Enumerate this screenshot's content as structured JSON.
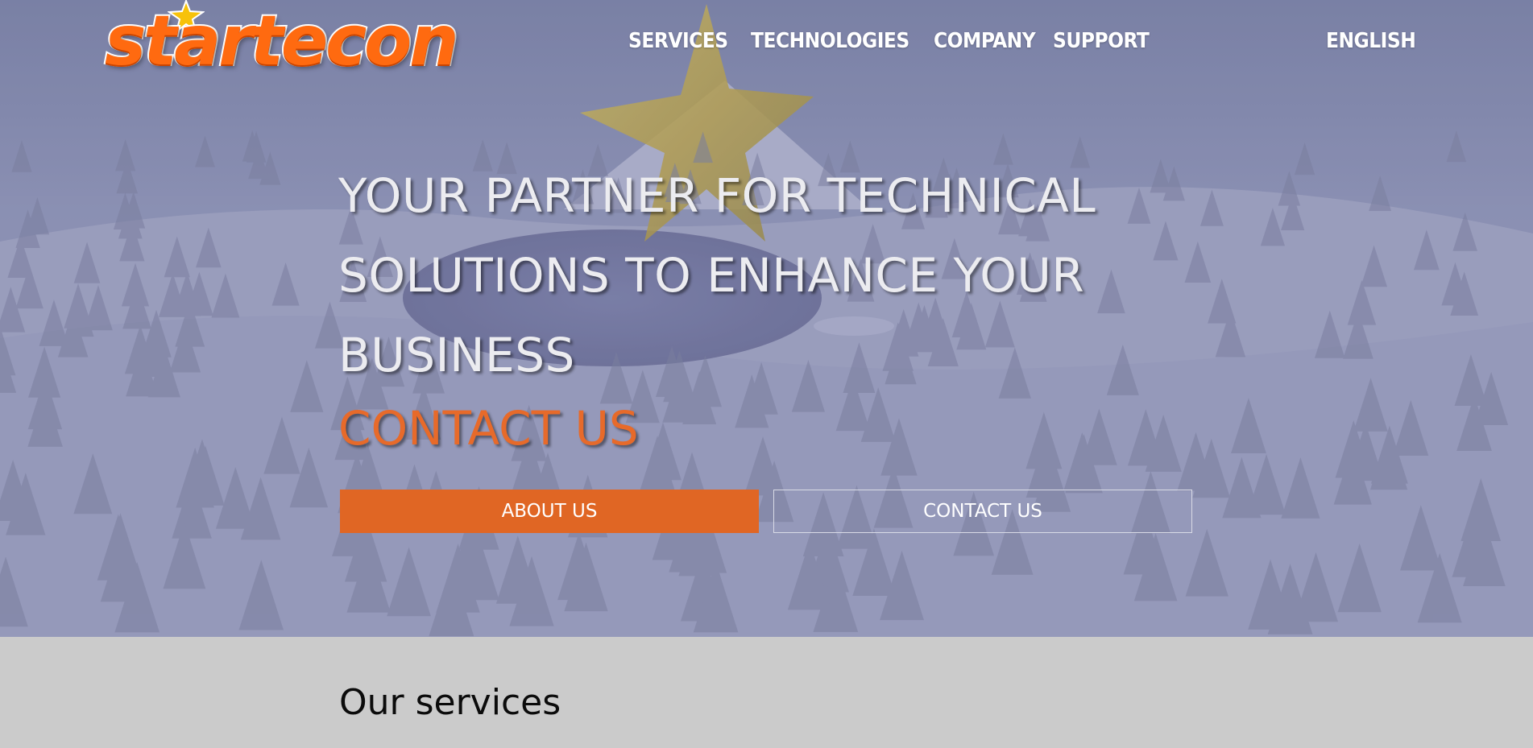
{
  "brand": {
    "logo_text": "startecon",
    "colors": {
      "orange": "#ff6a10",
      "accent": "#e06624"
    }
  },
  "nav": {
    "items": [
      {
        "label": "SERVICES"
      },
      {
        "label": "TECHNOLOGIES"
      },
      {
        "label": "COMPANY"
      },
      {
        "label": "SUPPORT"
      }
    ],
    "language": "ENGLISH"
  },
  "hero": {
    "headline_lines": [
      "YOUR PARTNER FOR TECHNICAL",
      "SOLUTIONS TO ENHANCE YOUR",
      "BUSINESS"
    ],
    "contact_link": "CONTACT US",
    "buttons": {
      "about": "ABOUT US",
      "contact": "CONTACT US"
    }
  },
  "services": {
    "title": "Our services"
  }
}
